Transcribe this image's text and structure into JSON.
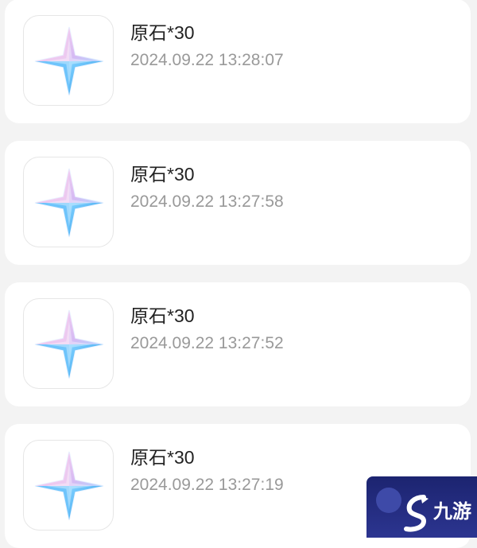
{
  "records": [
    {
      "title": "原石*30",
      "time": "2024.09.22 13:28:07",
      "icon": "primogem-icon"
    },
    {
      "title": "原石*30",
      "time": "2024.09.22 13:27:58",
      "icon": "primogem-icon"
    },
    {
      "title": "原石*30",
      "time": "2024.09.22 13:27:52",
      "icon": "primogem-icon"
    },
    {
      "title": "原石*30",
      "time": "2024.09.22 13:27:19",
      "icon": "primogem-icon"
    }
  ],
  "watermark": {
    "text": "九游",
    "icon": "jiuyou-logo-icon"
  },
  "colors": {
    "background": "#f3f3f3",
    "card": "#ffffff",
    "title_text": "#222222",
    "time_text": "#999999",
    "watermark_bg": "#1c2470"
  }
}
